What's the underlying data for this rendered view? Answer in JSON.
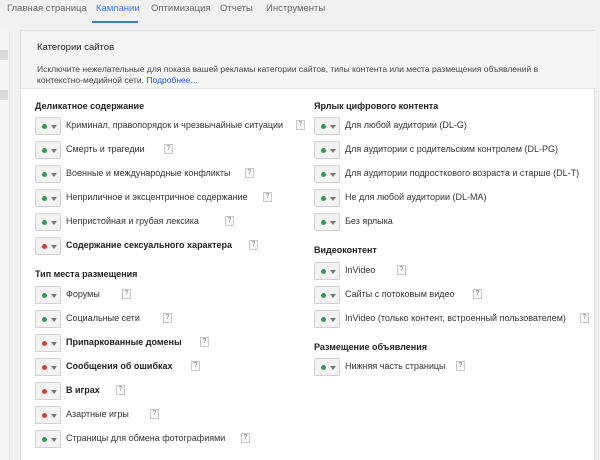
{
  "nav": {
    "tabs": [
      {
        "label": "Главная страница",
        "active": false
      },
      {
        "label": "Кампании",
        "active": true
      },
      {
        "label": "Оптимизация",
        "active": false
      },
      {
        "label": "Отчеты",
        "active": false
      },
      {
        "label": "Инструменты",
        "active": false
      }
    ]
  },
  "panel": {
    "title": "Категории сайтов",
    "description": "Исключите нежелательные для показа вашей рекламы категории сайтов, типы контента или места размещения объявлений в контекстно-медийной сети.",
    "more_link": "Подробнее..."
  },
  "help_glyph": "?",
  "colors": {
    "accent": "#3b78e7",
    "allowed": "#2e9b4e",
    "excluded": "#d23f31"
  },
  "left_column": {
    "sensitive": {
      "heading": "Деликатное содержание",
      "items": [
        {
          "label": "Криминал, правопорядок и чрезвычайные ситуации",
          "status": "allowed"
        },
        {
          "label": "Смерть и трагедии",
          "status": "allowed"
        },
        {
          "label": "Военные и международные конфликты",
          "status": "allowed"
        },
        {
          "label": "Неприличное и эксцентричное содержание",
          "status": "allowed"
        },
        {
          "label": "Непристойная и грубая лексика",
          "status": "allowed"
        },
        {
          "label": "Содержание сексуального характера",
          "status": "excluded"
        }
      ]
    },
    "placement_type": {
      "heading": "Тип места размещения",
      "items": [
        {
          "label": "Форумы",
          "status": "allowed"
        },
        {
          "label": "Социальные сети",
          "status": "allowed"
        },
        {
          "label": "Припаркованные домены",
          "status": "excluded"
        },
        {
          "label": "Сообщения об ошибках",
          "status": "excluded"
        },
        {
          "label": "В играх",
          "status": "excluded"
        },
        {
          "label": "Азартные игры",
          "status": "excluded"
        },
        {
          "label": "Страницы для обмена фотографиями",
          "status": "allowed"
        }
      ]
    }
  },
  "right_column": {
    "digital_label": {
      "heading": "Ярлык цифрового контента",
      "items": [
        {
          "label": "Для любой аудитории (DL-G)",
          "status": "allowed"
        },
        {
          "label": "Для аудитории с родительским контролем (DL-PG)",
          "status": "allowed"
        },
        {
          "label": "Для аудитории подросткового возраста и старше (DL-T)",
          "status": "allowed"
        },
        {
          "label": "Не для любой аудитории (DL-MA)",
          "status": "allowed"
        },
        {
          "label": "Без ярлыка",
          "status": "allowed"
        }
      ]
    },
    "video": {
      "heading": "Видеоконтент",
      "items": [
        {
          "label": "InVideo",
          "status": "allowed"
        },
        {
          "label": "Сайты с потоковым видео",
          "status": "allowed"
        },
        {
          "label": "InVideo (только контент, встроенный пользователем)",
          "status": "allowed"
        }
      ]
    },
    "ad_placement": {
      "heading": "Размещение объявления",
      "items": [
        {
          "label": "Нижняя часть страницы",
          "status": "allowed"
        }
      ]
    }
  }
}
